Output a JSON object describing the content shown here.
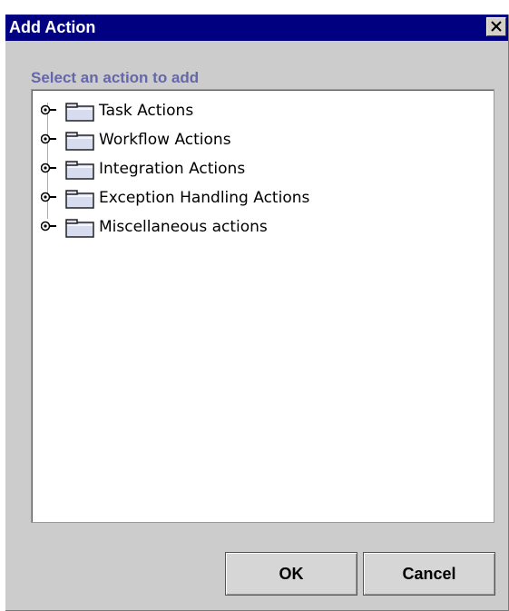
{
  "dialog": {
    "title": "Add Action",
    "close_icon": "close-icon"
  },
  "content": {
    "section_label": "Select an action to add"
  },
  "tree": {
    "nodes": [
      {
        "label": "Task Actions",
        "icon": "folder-icon",
        "expander": "expand-toggle-icon"
      },
      {
        "label": "Workflow Actions",
        "icon": "folder-icon",
        "expander": "expand-toggle-icon"
      },
      {
        "label": "Integration Actions",
        "icon": "folder-icon",
        "expander": "expand-toggle-icon"
      },
      {
        "label": "Exception Handling Actions",
        "icon": "folder-icon",
        "expander": "expand-toggle-icon"
      },
      {
        "label": "Miscellaneous actions",
        "icon": "folder-icon",
        "expander": "expand-toggle-icon"
      }
    ]
  },
  "buttons": {
    "ok_label": "OK",
    "cancel_label": "Cancel"
  },
  "colors": {
    "titlebar": "#000080",
    "section_label": "#6666aa",
    "dialog_background": "#cccccc"
  }
}
